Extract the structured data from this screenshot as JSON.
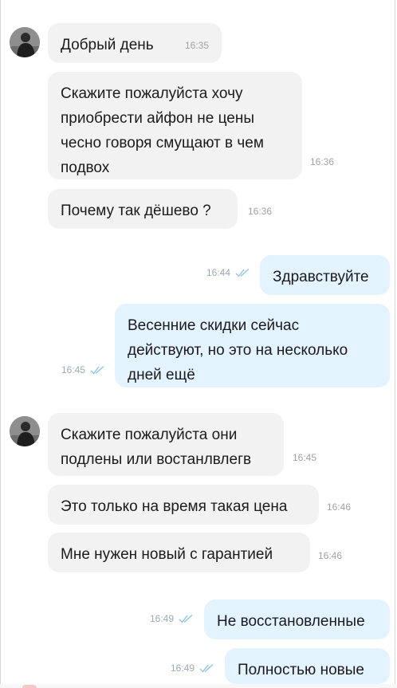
{
  "contact": {
    "avatar_icon": "person-photo-avatar"
  },
  "messages": [
    {
      "dir": "in",
      "text": "Добрый день",
      "time": "16:35"
    },
    {
      "dir": "in",
      "lines": [
        "Скажите пожалуйста хочу",
        "приобрести айфон не цены",
        "чесно говоря смущают в чем",
        "подвох"
      ],
      "time": "16:36"
    },
    {
      "dir": "in",
      "text": "Почему так дёшево ?",
      "time": "16:36"
    },
    {
      "dir": "out",
      "text": "Здравствуйте",
      "time": "16:44",
      "status_icon": "double-check-icon"
    },
    {
      "dir": "out",
      "lines": [
        "Весенние скидки сейчас",
        "действуют, но это на несколько",
        "дней ещё"
      ],
      "time": "16:45",
      "status_icon": "double-check-icon"
    },
    {
      "dir": "in",
      "lines": [
        "Скажите пожалуйста они",
        "подлены или востанлвлегв"
      ],
      "time": "16:45"
    },
    {
      "dir": "in",
      "text": "Это только на время такая цена",
      "time": "16:46"
    },
    {
      "dir": "in",
      "text": "Мне нужен новый с гарантией",
      "time": "16:46"
    },
    {
      "dir": "out",
      "text": "Не восстановленные",
      "time": "16:49",
      "status_icon": "double-check-icon"
    },
    {
      "dir": "out",
      "text": "Полностью новые",
      "time": "16:49",
      "status_icon": "double-check-icon"
    }
  ],
  "colors": {
    "incoming_bubble": "#f2f2f2",
    "outgoing_bubble": "#e3f3ff",
    "read_check": "#8fc4e8",
    "timestamp": "#a2a2a2"
  }
}
